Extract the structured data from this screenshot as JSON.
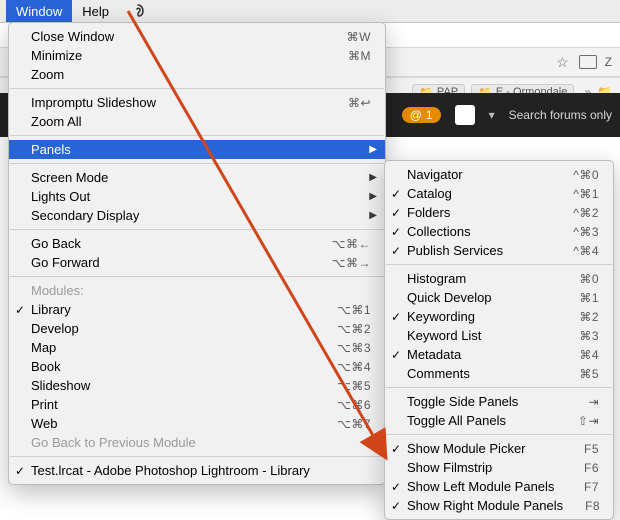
{
  "menubar": {
    "window": "Window",
    "help": "Help"
  },
  "background": {
    "addrbar_right_z": "Z",
    "bookmark_pap": "PAP",
    "bookmark_ormondale": "E - Ormondale",
    "notif_count": "1",
    "search_placeholder": "Search forums only"
  },
  "window_menu": {
    "close": "Close Window",
    "close_s": "⌘W",
    "minimize": "Minimize",
    "minimize_s": "⌘M",
    "zoom": "Zoom",
    "impromptu": "Impromptu Slideshow",
    "impromptu_s": "⌘↩",
    "zoom_all": "Zoom All",
    "panels": "Panels",
    "screen_mode": "Screen Mode",
    "lights_out": "Lights Out",
    "secondary": "Secondary Display",
    "go_back": "Go Back",
    "go_back_s": "⌥⌘←",
    "go_forward": "Go Forward",
    "go_forward_s": "⌥⌘→",
    "modules_hdr": "Modules:",
    "library": "Library",
    "library_s": "⌥⌘1",
    "develop": "Develop",
    "develop_s": "⌥⌘2",
    "map": "Map",
    "map_s": "⌥⌘3",
    "book": "Book",
    "book_s": "⌥⌘4",
    "slideshow": "Slideshow",
    "slideshow_s": "⌥⌘5",
    "print": "Print",
    "print_s": "⌥⌘6",
    "web": "Web",
    "web_s": "⌥⌘7",
    "go_back_prev": "Go Back to Previous Module",
    "doc_title": "Test.lrcat - Adobe Photoshop Lightroom - Library"
  },
  "panels_menu": {
    "navigator": "Navigator",
    "navigator_s": "^⌘0",
    "catalog": "Catalog",
    "catalog_s": "^⌘1",
    "folders": "Folders",
    "folders_s": "^⌘2",
    "collections": "Collections",
    "collections_s": "^⌘3",
    "publish": "Publish Services",
    "publish_s": "^⌘4",
    "histogram": "Histogram",
    "histogram_s": "⌘0",
    "quick": "Quick Develop",
    "quick_s": "⌘1",
    "keywording": "Keywording",
    "keywording_s": "⌘2",
    "keywordlist": "Keyword List",
    "keywordlist_s": "⌘3",
    "metadata": "Metadata",
    "metadata_s": "⌘4",
    "comments": "Comments",
    "comments_s": "⌘5",
    "toggle_side": "Toggle Side Panels",
    "toggle_side_s": "⇥",
    "toggle_all": "Toggle All Panels",
    "toggle_all_s": "⇧⇥",
    "show_module_picker": "Show Module Picker",
    "show_module_picker_s": "F5",
    "show_filmstrip": "Show Filmstrip",
    "show_filmstrip_s": "F6",
    "show_left": "Show Left Module Panels",
    "show_left_s": "F7",
    "show_right": "Show Right Module Panels",
    "show_right_s": "F8"
  }
}
